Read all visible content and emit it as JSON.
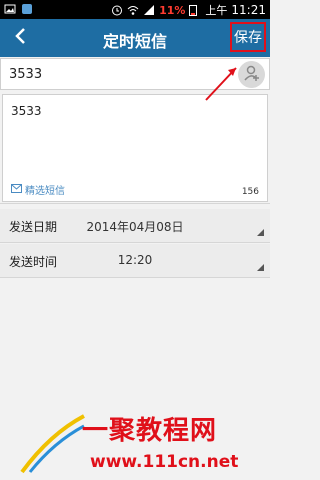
{
  "status_bar": {
    "battery": "11%",
    "am_pm": "上午",
    "time": "11:21"
  },
  "header": {
    "title": "定时短信",
    "save_label": "保存"
  },
  "recipient": {
    "value": "3533"
  },
  "message": {
    "value": "3533",
    "template_label": "精选短信",
    "char_count": "156"
  },
  "schedule": {
    "date_label": "发送日期",
    "date_value": "2014年04月08日",
    "time_label": "发送时间",
    "time_value": "12:20"
  },
  "watermark": {
    "logo_text": "一聚教程网",
    "url": "www.111cn.net"
  },
  "colors": {
    "header_bg": "#1e6da3",
    "annotation_red": "#e0101a",
    "link_blue": "#4a8bc2"
  }
}
